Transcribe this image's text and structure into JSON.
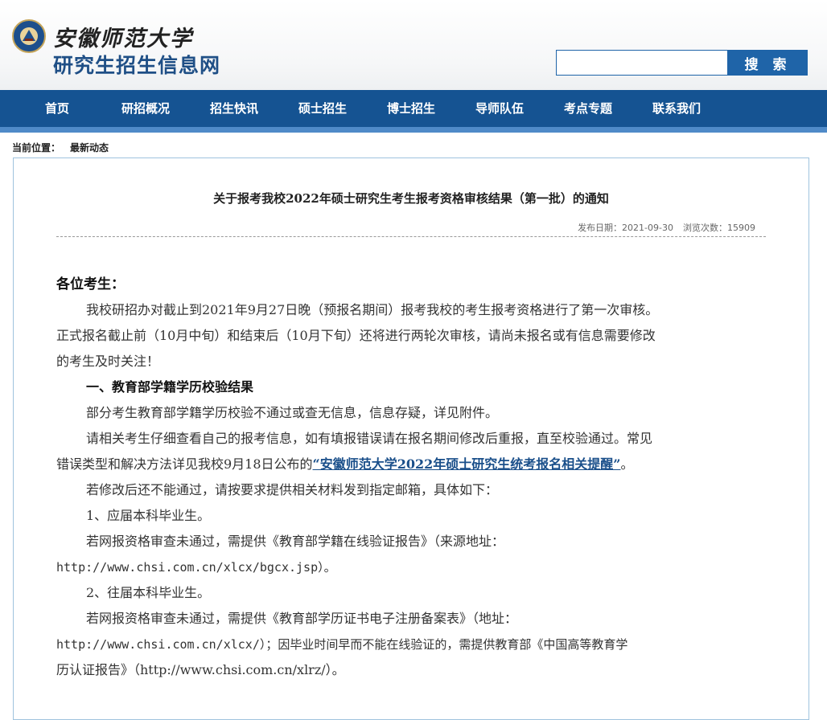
{
  "header": {
    "school_name": "安徽师范大学",
    "site_name": "研究生招生信息网",
    "search": {
      "placeholder": "",
      "button_label": "搜 索"
    }
  },
  "nav": {
    "items": [
      {
        "label": "首页"
      },
      {
        "label": "研招概况"
      },
      {
        "label": "招生快讯"
      },
      {
        "label": "硕士招生"
      },
      {
        "label": "博士招生"
      },
      {
        "label": "导师队伍"
      },
      {
        "label": "考点专题"
      },
      {
        "label": "联系我们"
      }
    ]
  },
  "breadcrumb": {
    "label": "当前位置：",
    "current": "最新动态"
  },
  "article": {
    "title": "关于报考我校2022年硕士研究生考生报考资格审核结果（第一批）的通知",
    "publish_date": "发布日期：2021-09-30",
    "views": "浏览次数：15909",
    "greeting": "各位考生：",
    "p1_l1": "我校研招办对截止到2021年9月27日晚（预报名期间）报考我校的考生报考资格进行了第一次审核。",
    "p1_l2": "正式报名截止前（10月中旬）和结束后（10月下旬）还将进行两轮次审核，请尚未报名或有信息需要修改",
    "p1_l3": "的考生及时关注！",
    "h1": "一、教育部学籍学历校验结果",
    "p2": "部分考生教育部学籍学历校验不通过或查无信息，信息存疑，详见附件。",
    "p3_l1": "请相关考生仔细查看自己的报考信息，如有填报错误请在报名期间修改后重报，直至校验通过。常见",
    "p3_l2_pre": "错误类型和解决方法详见我校9月18日公布的",
    "p3_link": "“安徽师范大学2022年硕士研究生统考报名相关提醒”",
    "p3_l2_post": "。",
    "p4": "若修改后还不能通过，请按要求提供相关材料发到指定邮箱，具体如下：",
    "item1": "1、应届本科毕业生。",
    "item1_l1": "若网报资格审查未通过，需提供《教育部学籍在线验证报告》（来源地址：",
    "item1_l2": "http://www.chsi.com.cn/xlcx/bgcx.jsp）。",
    "item2": "2、往届本科毕业生。",
    "item2_l1": "若网报资格审查未通过，需提供《教育部学历证书电子注册备案表》（地址：",
    "item2_l2": "http://www.chsi.com.cn/xlcx/）；因毕业时间早而不能在线验证的，需提供教育部《中国高等教育学",
    "item2_l3": "历认证报告》（http://www.chsi.com.cn/xlrz/）。"
  },
  "colors": {
    "nav_bg": "#155392",
    "nav_accent": "#4f8ac8",
    "site_name": "#1f4f86",
    "link": "#1a4f8a",
    "search_button": "#1f64a8"
  }
}
